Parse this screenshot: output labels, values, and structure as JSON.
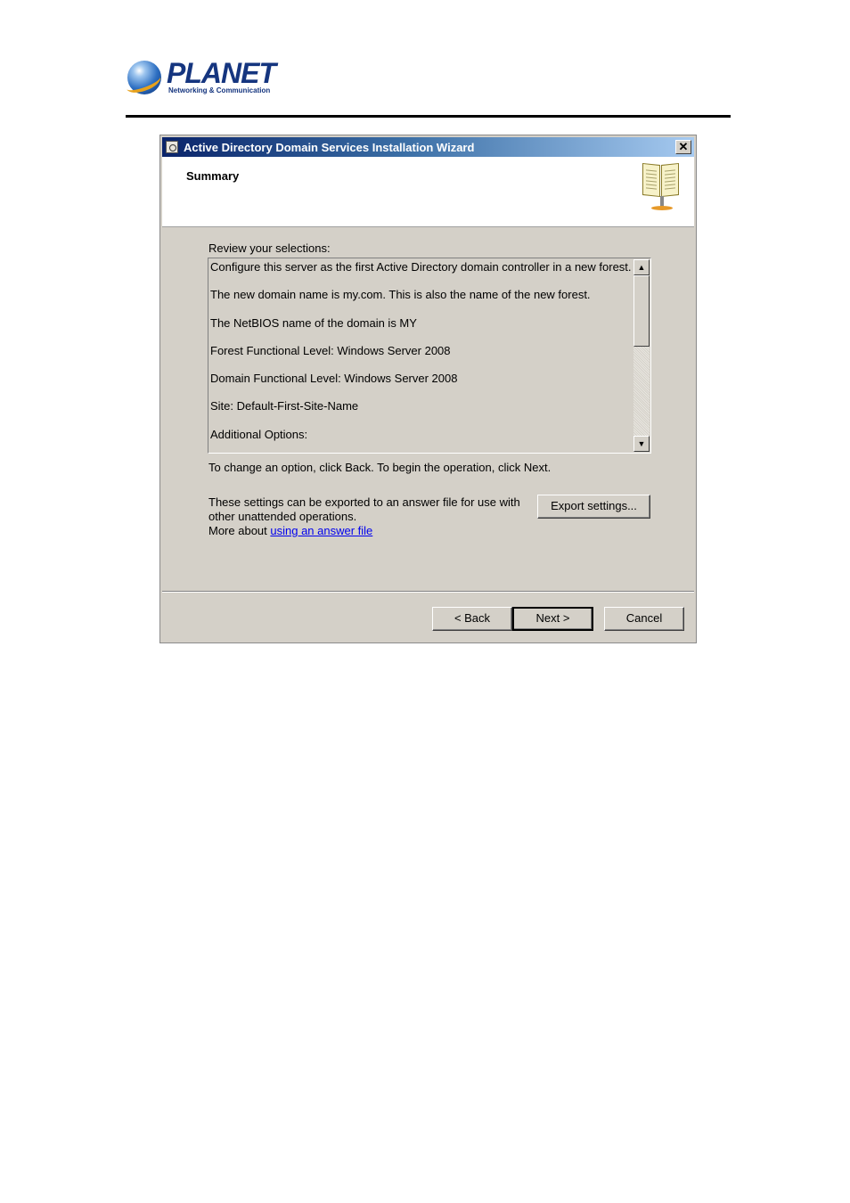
{
  "brand": {
    "name": "PLANET",
    "tagline": "Networking & Communication"
  },
  "window": {
    "title": "Active Directory Domain Services Installation Wizard",
    "close_glyph": "✕",
    "page_title": "Summary"
  },
  "review": {
    "label": "Review your selections:",
    "lines": [
      "Configure this server as the first Active Directory domain controller in a new forest.",
      "The new domain name is my.com. This is also the name of the new forest.",
      "The NetBIOS name of the domain is MY",
      "Forest Functional Level: Windows Server 2008",
      "Domain Functional Level: Windows Server 2008",
      "Site: Default-First-Site-Name",
      "Additional Options:"
    ],
    "scroll_up_glyph": "▲",
    "scroll_down_glyph": "▼"
  },
  "instructions": {
    "change_option": "To change an option, click Back. To begin the operation, click Next.",
    "export_info": "These settings can be exported to an answer file for use with other unattended operations.",
    "more_about_prefix": "More about",
    "more_about_link": "using an answer file"
  },
  "buttons": {
    "export": "Export settings...",
    "back": "< Back",
    "next": "Next >",
    "cancel": "Cancel"
  },
  "icons": {
    "app_icon": "wizard-app-icon",
    "header_icon": "book-on-stand-icon"
  }
}
